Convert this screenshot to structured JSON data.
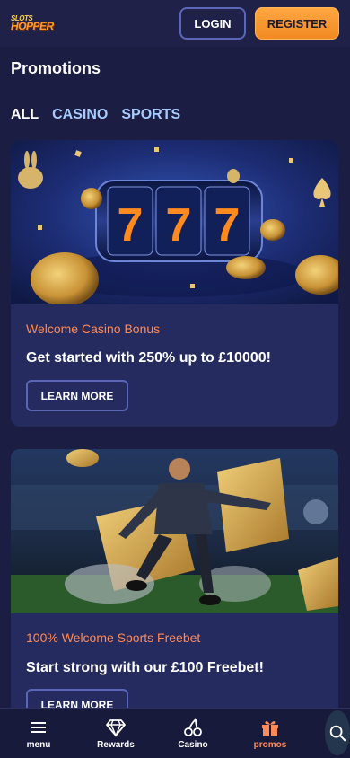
{
  "header": {
    "logo_top": "SLOTS",
    "logo_bottom": "HOPPER",
    "login_label": "LOGIN",
    "register_label": "REGISTER"
  },
  "page_title": "Promotions",
  "filters": [
    "ALL",
    "CASINO",
    "SPORTS"
  ],
  "promos": [
    {
      "kicker": "Welcome Casino Bonus",
      "headline": "Get started with 250% up to £10000!",
      "cta": "LEARN MORE",
      "image": "slot-machine-777-coins-bunnies"
    },
    {
      "kicker": "100% Welcome Sports Freebet",
      "headline": "Start strong with our £100 Freebet!",
      "cta": "LEARN MORE",
      "image": "footballer-kicking-golden-tickets"
    }
  ],
  "bottom_nav": [
    {
      "label": "menu",
      "icon": "hamburger-icon"
    },
    {
      "label": "Rewards",
      "icon": "diamond-icon"
    },
    {
      "label": "Casino",
      "icon": "cherries-icon"
    },
    {
      "label": "promos",
      "icon": "gift-icon"
    }
  ],
  "colors": {
    "background": "#1b1d42",
    "card": "#252a5f",
    "accent_orange": "#f18a22",
    "kicker": "#ff8a55",
    "filter_inactive": "#a8cbff"
  }
}
